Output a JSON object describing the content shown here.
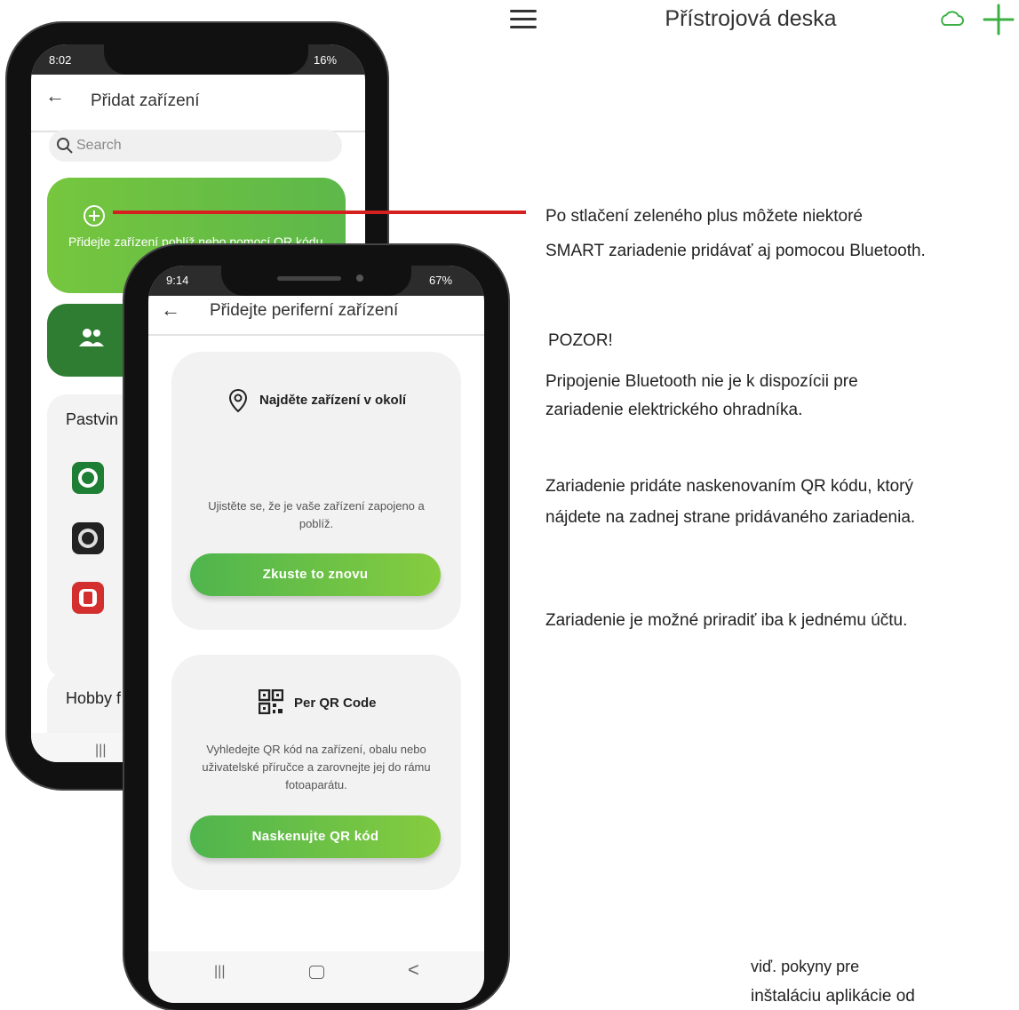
{
  "app_bar": {
    "title": "Přístrojová deska",
    "menu_icon": "hamburger-menu-icon",
    "cloud_icon": "cloud-icon",
    "add_icon": "plus-icon",
    "accent_color": "#3cb043"
  },
  "phone_back": {
    "status_time": "8:02",
    "status_right": "16%",
    "title": "Přidat zařízení",
    "search_placeholder": "Search",
    "add_card_text": "Přidejte zařízení poblíž nebo pomocí QR kódu",
    "section1": "Pastvin",
    "section2": "Hobby f",
    "nav_recent": "|||"
  },
  "phone_front": {
    "status_time": "9:14",
    "status_right": "67%",
    "title": "Přidejte periferní zařízení",
    "nearby": {
      "title": "Najděte zařízení v okolí",
      "text": "Ujistěte se, že je vaše zařízení zapojeno a poblíž.",
      "button": "Zkuste to znovu"
    },
    "qr": {
      "title": "Per QR Code",
      "text": "Vyhledejte QR kód na zařízení, obalu nebo uživatelské příručce a zarovnejte jej do rámu fotoaparátu.",
      "button": "Naskenujte QR kód"
    },
    "nav_recent": "|||",
    "nav_back": "<"
  },
  "notes": {
    "n1_line1": "Po stlačení zeleného plus môžete niektoré",
    "n1_line2": "SMART zariadenie pridávať aj pomocou Bluetooth.",
    "n2_heading": "POZOR!",
    "n2_line1": "Pripojenie Bluetooth nie je k dispozícii pre",
    "n2_line2": "zariadenie elektrického ohradníka.",
    "n3_line1": "Zariadenie pridáte naskenovaním QR kódu, ktorý",
    "n3_line2": "nájdete na zadnej strane pridávaného zariadenia.",
    "n4": "Zariadenie je možné priradiť iba k jednému účtu.",
    "n5_line1": "viď. pokyny pre",
    "n5_line2": "inštaláciu aplikácie od"
  }
}
